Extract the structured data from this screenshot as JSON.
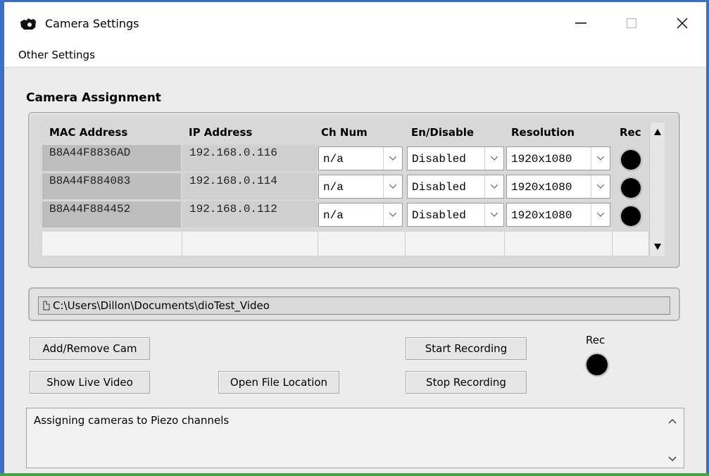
{
  "window": {
    "title": "Camera Settings"
  },
  "menu": {
    "items": [
      "Other Settings"
    ]
  },
  "section": {
    "title": "Camera Assignment"
  },
  "table": {
    "headers": [
      "MAC Address",
      "IP Address",
      "Ch Num",
      "En/Disable",
      "Resolution",
      "Rec"
    ],
    "rows": [
      {
        "mac": "B8A44F8836AD",
        "ip": "192.168.0.116",
        "ch": "n/a",
        "enable": "Disabled",
        "resolution": "1920x1080"
      },
      {
        "mac": "B8A44F884083",
        "ip": "192.168.0.114",
        "ch": "n/a",
        "enable": "Disabled",
        "resolution": "1920x1080"
      },
      {
        "mac": "B8A44F884452",
        "ip": "192.168.0.112",
        "ch": "n/a",
        "enable": "Disabled",
        "resolution": "1920x1080"
      }
    ]
  },
  "path": {
    "value": "C:\\Users\\Dillon\\Documents\\dioTest_Video"
  },
  "buttons": {
    "add_remove": "Add/Remove Cam",
    "show_live": "Show Live Video",
    "open_file": "Open File Location",
    "start_rec": "Start Recording",
    "stop_rec": "Stop Recording"
  },
  "rec": {
    "label": "Rec"
  },
  "log": {
    "text": "Assigning cameras to Piezo channels"
  },
  "icons": {
    "app": "camera-icon",
    "minimize": "minimize-icon",
    "maximize": "maximize-icon",
    "close": "close-icon",
    "dropdown": "chevron-down-icon",
    "path": "folder-icon"
  },
  "colors": {
    "window_border": "#3d6fc4",
    "rec_indicator": "#000000"
  }
}
